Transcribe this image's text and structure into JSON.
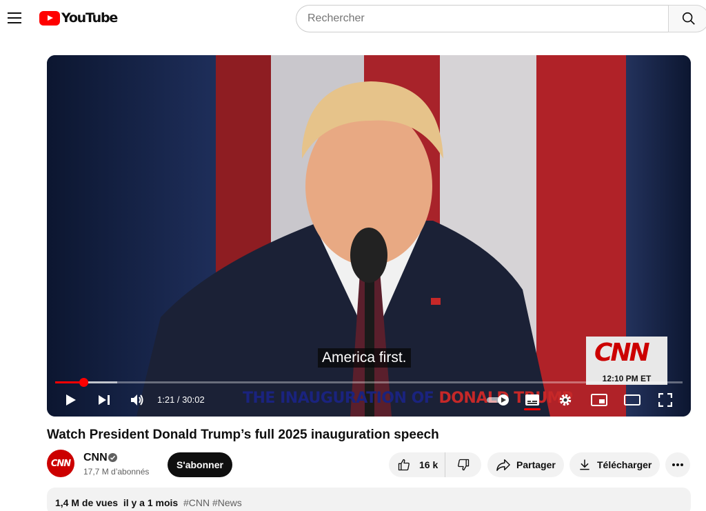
{
  "header": {
    "logo_text": "YouTube",
    "search_placeholder": "Rechercher"
  },
  "player": {
    "subtitle": "America first.",
    "cnn_bug_logo": "CNN",
    "cnn_bug_time": "12:10 PM ET",
    "banner_text_part1": "THE INAUGURATION OF ",
    "banner_text_part2": "DONALD TRUMP",
    "time_display": "1:21 / 30:02",
    "progress_fraction": 0.045,
    "buffered_fraction": 0.099,
    "controls": [
      "play-icon",
      "next-icon",
      "volume-icon",
      "autoplay-toggle-icon",
      "subtitles-icon",
      "settings-icon",
      "miniplayer-icon",
      "theater-mode-icon",
      "fullscreen-icon"
    ]
  },
  "video": {
    "title": "Watch President Donald Trump’s full 2025 inauguration speech"
  },
  "channel": {
    "avatar_text": "CNN",
    "name": "CNN",
    "subscribers": "17,7 M d’abonnés",
    "subscribe_label": "S'abonner"
  },
  "actions": {
    "likes": "16 k",
    "share_label": "Partager",
    "download_label": "Télécharger"
  },
  "description": {
    "views": "1,4 M de vues",
    "age": "il y a 1 mois",
    "tags": "#CNN #News"
  },
  "colors": {
    "accent": "#ff0000",
    "cnn_red": "#cc0000"
  }
}
